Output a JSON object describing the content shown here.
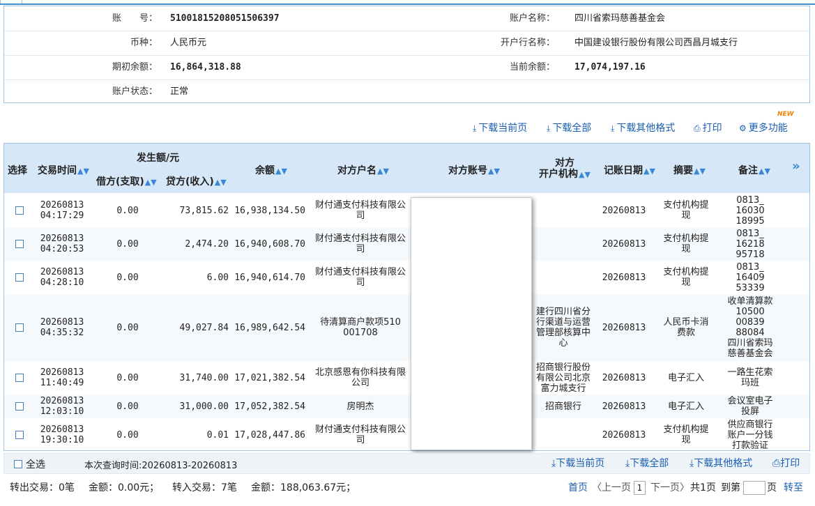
{
  "account": {
    "acct_no_label": "账　　号：",
    "acct_no": "51001815208051506397",
    "acct_name_label": "账户名称：",
    "acct_name": "四川省索玛慈善基金会",
    "currency_label": "币种：",
    "currency": "人民币元",
    "bank_label": "开户行名称：",
    "bank": "中国建设银行股份有限公司西昌月城支行",
    "opening_label": "期初余额：",
    "opening": "16,864,318.88",
    "current_label": "当前余额：",
    "current": "17,074,197.16",
    "status_label": "账户状态：",
    "status": "正常"
  },
  "toolbar": {
    "download_page": "下载当前页",
    "download_all": "下载全部",
    "download_other": "下载其他格式",
    "print": "打印",
    "more": "更多功能",
    "new_tag": "NEW"
  },
  "table": {
    "headers": {
      "select": "选择",
      "time": "交易时间",
      "amount_group": "发生额/元",
      "debit": "借方(支取)",
      "credit": "贷方(收入)",
      "balance": "余额",
      "cp_name": "对方户名",
      "cp_acct": "对方账号",
      "cp_bank_1": "对方",
      "cp_bank_2": "开户机构",
      "post_date": "记账日期",
      "summary": "摘要",
      "remark": "备注",
      "more": "»"
    },
    "rows": [
      {
        "date": "20260813",
        "time": "04:17:29",
        "debit": "0.00",
        "credit": "73,815.62",
        "balance": "16,938,134.50",
        "cp_name_1": "财付通支付科技有限公",
        "cp_name_2": "司",
        "bank_1": "",
        "bank_2": "",
        "bank_3": "",
        "bank_4": "",
        "post": "20260813",
        "sum_1": "支付机构提",
        "sum_2": "现",
        "rem_1": "0813_",
        "rem_2": "16030",
        "rem_3": "18995",
        "rem_4": "",
        "rem_5": "",
        "rem_6": ""
      },
      {
        "date": "20260813",
        "time": "04:20:53",
        "debit": "0.00",
        "credit": "2,474.20",
        "balance": "16,940,608.70",
        "cp_name_1": "财付通支付科技有限公",
        "cp_name_2": "司",
        "bank_1": "",
        "bank_2": "",
        "bank_3": "",
        "bank_4": "",
        "post": "20260813",
        "sum_1": "支付机构提",
        "sum_2": "现",
        "rem_1": "0813_",
        "rem_2": "16218",
        "rem_3": "95718",
        "rem_4": "",
        "rem_5": "",
        "rem_6": ""
      },
      {
        "date": "20260813",
        "time": "04:28:10",
        "debit": "0.00",
        "credit": "6.00",
        "balance": "16,940,614.70",
        "cp_name_1": "财付通支付科技有限公",
        "cp_name_2": "司",
        "bank_1": "",
        "bank_2": "",
        "bank_3": "",
        "bank_4": "",
        "post": "20260813",
        "sum_1": "支付机构提",
        "sum_2": "现",
        "rem_1": "0813_",
        "rem_2": "16409",
        "rem_3": "53339",
        "rem_4": "",
        "rem_5": "",
        "rem_6": ""
      },
      {
        "date": "20260813",
        "time": "04:35:32",
        "debit": "0.00",
        "credit": "49,027.84",
        "balance": "16,989,642.54",
        "cp_name_1": "待清算商户款项510",
        "cp_name_2": "001708",
        "bank_1": "建行四川省分",
        "bank_2": "行渠道与运营",
        "bank_3": "管理部核算中",
        "bank_4": "心",
        "post": "20260813",
        "sum_1": "人民币卡消",
        "sum_2": "费款",
        "rem_1": "收单清算款",
        "rem_2": "10500",
        "rem_3": "00839",
        "rem_4": "88084",
        "rem_5": "四川省索玛",
        "rem_6": "慈善基金会"
      },
      {
        "date": "20260813",
        "time": "11:40:49",
        "debit": "0.00",
        "credit": "31,740.00",
        "balance": "17,021,382.54",
        "cp_name_1": "北京感恩有你科技有限",
        "cp_name_2": "公司",
        "bank_1": "招商银行股份",
        "bank_2": "有限公司北京",
        "bank_3": "富力城支行",
        "bank_4": "",
        "post": "20260813",
        "sum_1": "电子汇入",
        "sum_2": "",
        "rem_1": "一路生花索",
        "rem_2": "玛班",
        "rem_3": "",
        "rem_4": "",
        "rem_5": "",
        "rem_6": ""
      },
      {
        "date": "20260813",
        "time": "12:03:10",
        "debit": "0.00",
        "credit": "31,000.00",
        "balance": "17,052,382.54",
        "cp_name_1": "房明杰",
        "cp_name_2": "",
        "bank_1": "招商银行",
        "bank_2": "",
        "bank_3": "",
        "bank_4": "",
        "post": "20260813",
        "sum_1": "电子汇入",
        "sum_2": "",
        "rem_1": "会议室电子",
        "rem_2": "投屏",
        "rem_3": "",
        "rem_4": "",
        "rem_5": "",
        "rem_6": ""
      },
      {
        "date": "20260813",
        "time": "19:30:10",
        "debit": "0.00",
        "credit": "0.01",
        "balance": "17,028,447.86",
        "cp_name_1": "财付通支付科技有限公",
        "cp_name_2": "司",
        "bank_1": "",
        "bank_2": "",
        "bank_3": "",
        "bank_4": "",
        "post": "20260813",
        "sum_1": "支付机构提",
        "sum_2": "现",
        "rem_1": "供应商银行",
        "rem_2": "账户一分钱",
        "rem_3": "打款验证",
        "rem_4": "",
        "rem_5": "",
        "rem_6": ""
      }
    ]
  },
  "footer": {
    "select_all": "全选",
    "query_time": "本次查询时间:20260813-20260813",
    "download_page": "下载当前页",
    "download_all": "下载全部",
    "download_other": "下载其他格式",
    "print": "打印",
    "out_count": "转出交易：0笔",
    "out_amount": "金额：0.00元；",
    "in_count": "转入交易：7笔",
    "in_amount": "金额：188,063.67元；",
    "first": "首页",
    "prev": "〈上一页",
    "page": "1",
    "next": "下一页〉",
    "total": "共1页",
    "goto": "到第",
    "page_unit": "页",
    "go": "转至"
  },
  "colors": {
    "accent": "#3c8fd1",
    "header_bg": "#d6e8f8",
    "link": "#1a5fb4",
    "new": "#f08000"
  }
}
